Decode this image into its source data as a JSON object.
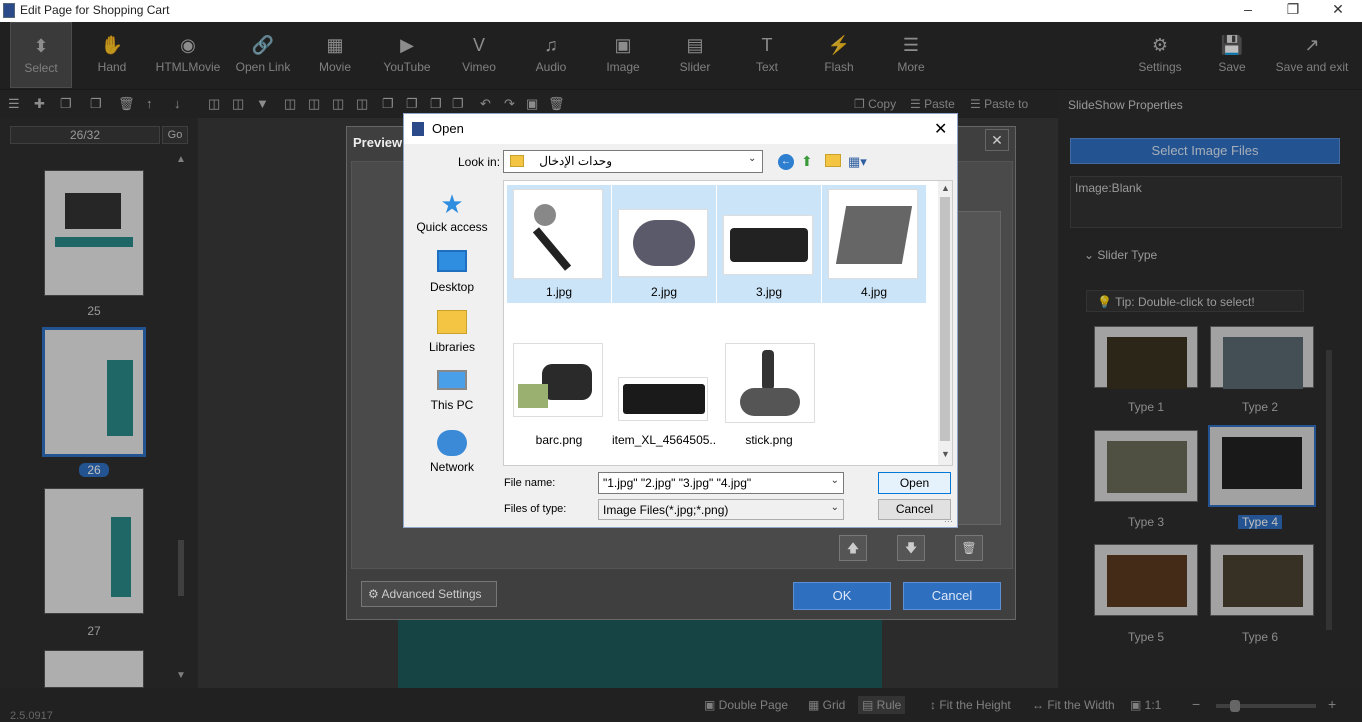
{
  "window": {
    "title": "Edit Page for Shopping Cart"
  },
  "toolbar": {
    "items": [
      {
        "label": "Select",
        "icon": "select-icon"
      },
      {
        "label": "Hand",
        "icon": "hand-icon"
      },
      {
        "label": "HTMLMovie",
        "icon": "film-reel-icon"
      },
      {
        "label": "Open Link",
        "icon": "link-icon"
      },
      {
        "label": "Movie",
        "icon": "movie-icon"
      },
      {
        "label": "YouTube",
        "icon": "youtube-icon"
      },
      {
        "label": "Vimeo",
        "icon": "vimeo-icon"
      },
      {
        "label": "Audio",
        "icon": "music-note-icon"
      },
      {
        "label": "Image",
        "icon": "image-icon"
      },
      {
        "label": "Slider",
        "icon": "slider-icon"
      },
      {
        "label": "Text",
        "icon": "text-icon"
      },
      {
        "label": "Flash",
        "icon": "flash-icon"
      },
      {
        "label": "More",
        "icon": "more-icon"
      }
    ],
    "right_items": [
      {
        "label": "Settings",
        "icon": "gear-icon"
      },
      {
        "label": "Save",
        "icon": "save-icon"
      },
      {
        "label": "Save and exit",
        "icon": "exit-icon"
      }
    ]
  },
  "toolbar2": {
    "copy": "Copy",
    "paste": "Paste",
    "paste_to": "Paste to"
  },
  "pages": {
    "current": "26/32",
    "go": "Go",
    "labels": [
      "25",
      "26",
      "27"
    ]
  },
  "right_panel": {
    "title": "SlideShow Properties",
    "select_button": "Select Image Files",
    "image_label": "Image:Blank",
    "slider_type": "Slider Type",
    "tip": "Tip: Double-click to select!",
    "types": [
      "Type 1",
      "Type 2",
      "Type 3",
      "Type 4",
      "Type 5",
      "Type 6"
    ],
    "selected_type": "Type 4"
  },
  "preview": {
    "title": "Preview",
    "advanced": "Advanced Settings",
    "ok": "OK",
    "cancel": "Cancel"
  },
  "open_dialog": {
    "title": "Open",
    "look_in_label": "Look in:",
    "look_in_value": "وحدات الإدخال",
    "nav": [
      "Quick access",
      "Desktop",
      "Libraries",
      "This PC",
      "Network"
    ],
    "files": [
      {
        "name": "1.jpg",
        "selected": true
      },
      {
        "name": "2.jpg",
        "selected": true
      },
      {
        "name": "3.jpg",
        "selected": true
      },
      {
        "name": "4.jpg",
        "selected": true
      },
      {
        "name": "barc.png",
        "selected": false
      },
      {
        "name": "item_XL_4564505...",
        "selected": false
      },
      {
        "name": "stick.png",
        "selected": false
      }
    ],
    "file_name_label": "File name:",
    "file_name_value": "\"1.jpg\" \"2.jpg\" \"3.jpg\" \"4.jpg\"",
    "file_type_label": "Files of type:",
    "file_type_value": "Image Files(*.jpg;*.png)",
    "open_button": "Open",
    "cancel_button": "Cancel"
  },
  "bottombar": {
    "version": "2.5.0917",
    "double_page": "Double Page",
    "grid": "Grid",
    "rule": "Rule",
    "fit_height": "Fit the Height",
    "fit_width": "Fit the Width",
    "zoom": "1:1"
  }
}
